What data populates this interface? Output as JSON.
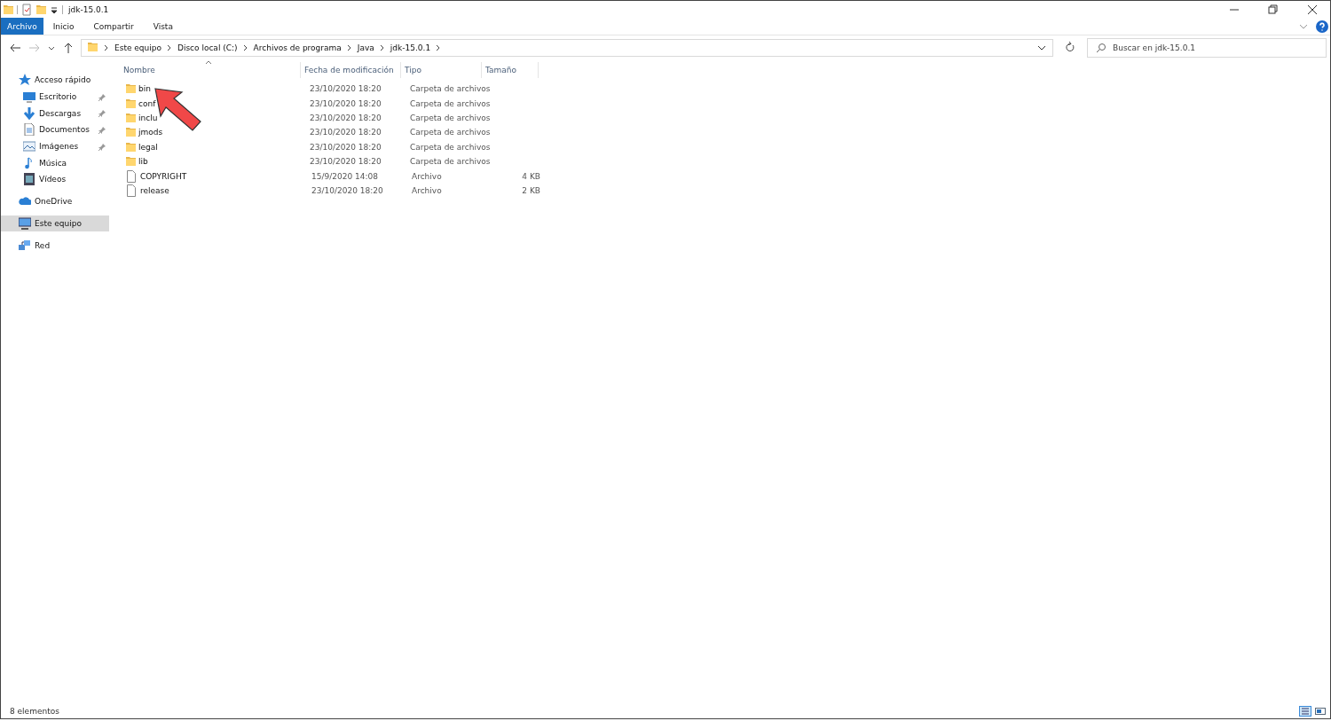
{
  "window": {
    "title": "jdk-15.0.1"
  },
  "ribbon_tabs": [
    {
      "label": "Archivo",
      "selected": true
    },
    {
      "label": "Inicio",
      "selected": false
    },
    {
      "label": "Compartir",
      "selected": false
    },
    {
      "label": "Vista",
      "selected": false
    }
  ],
  "breadcrumb": [
    "Este equipo",
    "Disco local (C:)",
    "Archivos de programa",
    "Java",
    "jdk-15.0.1"
  ],
  "search": {
    "placeholder": "Buscar en jdk-15.0.1"
  },
  "sidebar": {
    "items": [
      {
        "label": "Acceso rápido",
        "kind": "star",
        "pinned": false,
        "selected": false,
        "children": [
          {
            "label": "Escritorio",
            "kind": "desktop",
            "pinned": true,
            "selected": false
          },
          {
            "label": "Descargas",
            "kind": "download",
            "pinned": true,
            "selected": false
          },
          {
            "label": "Documentos",
            "kind": "document",
            "pinned": true,
            "selected": false
          },
          {
            "label": "Imágenes",
            "kind": "pictures",
            "pinned": true,
            "selected": false
          },
          {
            "label": "Música",
            "kind": "music",
            "pinned": false,
            "selected": false
          },
          {
            "label": "Vídeos",
            "kind": "video",
            "pinned": false,
            "selected": false
          }
        ]
      },
      {
        "label": "OneDrive",
        "kind": "cloud",
        "pinned": false,
        "selected": false
      },
      {
        "label": "Este equipo",
        "kind": "computer",
        "pinned": false,
        "selected": true
      },
      {
        "label": "Red",
        "kind": "network",
        "pinned": false,
        "selected": false
      }
    ]
  },
  "table": {
    "columns": [
      "Nombre",
      "Fecha de modificación",
      "Tipo",
      "Tamaño"
    ],
    "rows": [
      {
        "kind": "folder",
        "name": "bin",
        "date": "23/10/2020 18:20",
        "type": "Carpeta de archivos"
      },
      {
        "kind": "folder",
        "name": "conf",
        "date": "23/10/2020 18:20",
        "type": "Carpeta de archivos"
      },
      {
        "kind": "folder",
        "name": "inclu",
        "date": "23/10/2020 18:20",
        "type": "Carpeta de archivos"
      },
      {
        "kind": "folder",
        "name": "jmods",
        "date": "23/10/2020 18:20",
        "type": "Carpeta de archivos"
      },
      {
        "kind": "folder",
        "name": "legal",
        "date": "23/10/2020 18:20",
        "type": "Carpeta de archivos"
      },
      {
        "kind": "folder",
        "name": "lib",
        "date": "23/10/2020 18:20",
        "type": "Carpeta de archivos"
      },
      {
        "kind": "file",
        "name": "COPYRIGHT",
        "date": "15/9/2020 14:08",
        "type": "Archivo",
        "size": "4 KB"
      },
      {
        "kind": "file",
        "name": "release",
        "date": "23/10/2020 18:20",
        "type": "Archivo",
        "size": "2 KB"
      }
    ]
  },
  "status_bar": {
    "count": "8 elementos"
  }
}
